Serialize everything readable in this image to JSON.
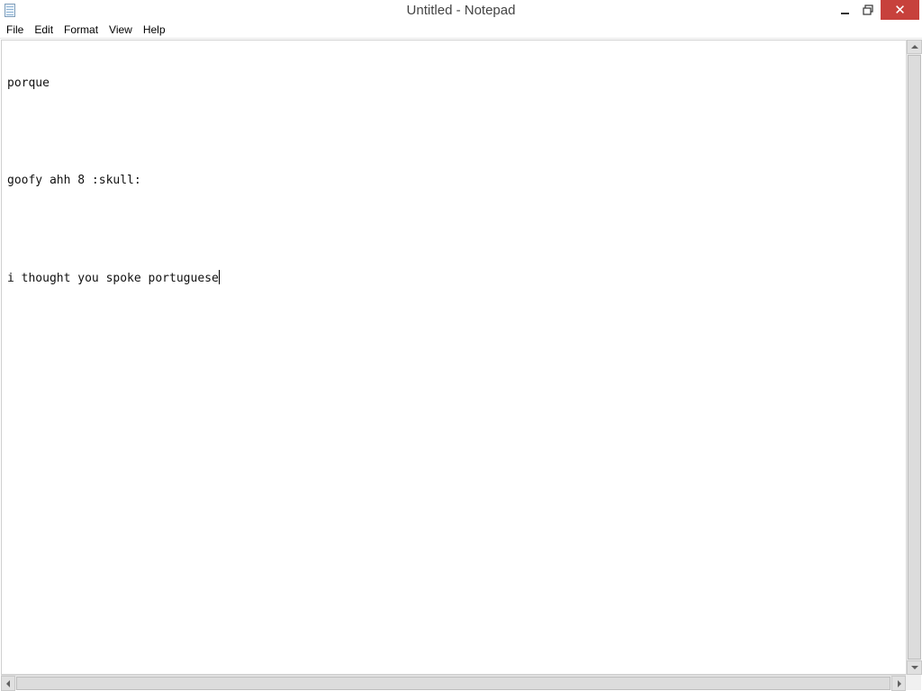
{
  "window": {
    "title": "Untitled - Notepad",
    "close_glyph": "✕"
  },
  "menu": {
    "items": [
      "File",
      "Edit",
      "Format",
      "View",
      "Help"
    ]
  },
  "editor": {
    "lines": [
      "porque",
      "",
      "goofy ahh 8 :skull:",
      "",
      "i thought you spoke portuguese"
    ]
  },
  "icons": {
    "app": "notepad-icon",
    "minimize": "minimize-icon",
    "restore": "restore-icon",
    "close": "close-icon"
  },
  "colors": {
    "close_button": "#c7413c",
    "text": "#111111",
    "background": "#ffffff"
  }
}
